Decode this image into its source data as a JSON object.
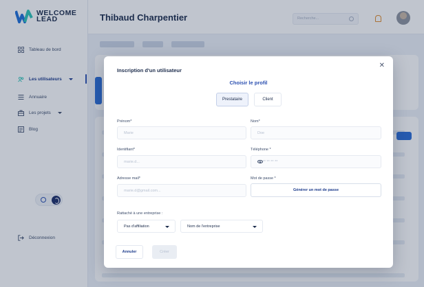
{
  "app": {
    "logo_line1": "WELCOME",
    "logo_line2": "LEAD"
  },
  "sidebar": {
    "items": [
      {
        "label": "Tableau de bord",
        "icon": "dashboard-icon"
      },
      {
        "label": "Les utilisateurs",
        "icon": "users-icon"
      },
      {
        "label": "Annuaire",
        "icon": "list-icon"
      },
      {
        "label": "Les projets",
        "icon": "briefcase-icon"
      },
      {
        "label": "Blog",
        "icon": "blog-icon"
      }
    ],
    "logout_label": "Déconnexion",
    "theme_toggle_letter": "D"
  },
  "header": {
    "user_name": "Thibaud Charpentier",
    "search_placeholder": "Recherche..."
  },
  "modal": {
    "title": "Inscription d'un utilisateur",
    "profile_heading": "Choisir le profil",
    "profile_options": [
      "Prestataire",
      "Client"
    ],
    "selected_profile": "Prestataire",
    "fields": {
      "prenom": {
        "label": "Prénom*",
        "placeholder": "Marie"
      },
      "nom": {
        "label": "Nom*",
        "placeholder": "Doe"
      },
      "identifiant": {
        "label": "Identifiant*",
        "placeholder": "marie.d..."
      },
      "telephone": {
        "label": "Téléphone *",
        "placeholder": "06 ** ** ** **"
      },
      "email": {
        "label": "Adresse mail*",
        "placeholder": "marie.d@gmail.com..."
      },
      "password": {
        "label": "Mot de passe *"
      }
    },
    "generate_password_label": "Générer un mot de passe",
    "company_section_label": "Rattaché à une entreprise :",
    "affiliation_select": "Pas d'affiliation",
    "company_select": "Nom de l'entreprise",
    "cancel_label": "Annuler",
    "create_label": "Créer"
  },
  "colors": {
    "brand_blue": "#2a4fb0",
    "navy": "#1b2b4b",
    "bell_orange": "#e08a2a"
  }
}
